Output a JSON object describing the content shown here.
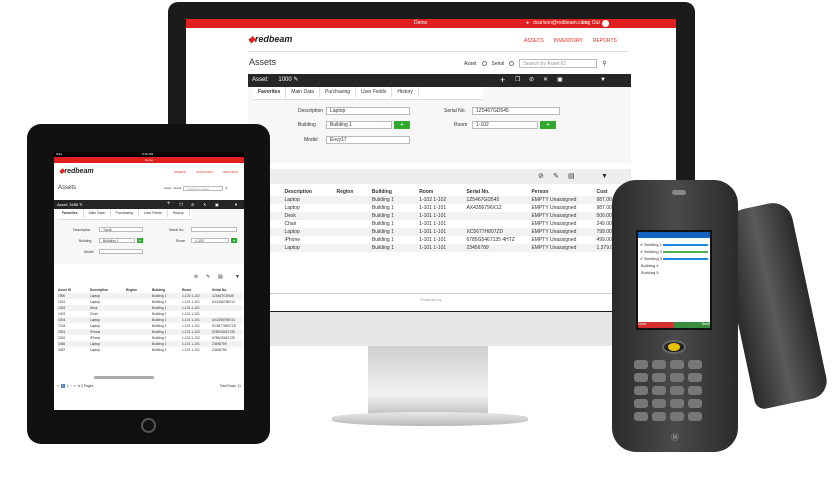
{
  "desktop": {
    "top": {
      "title": "Demo",
      "user": "dcarlson@redbeam.com",
      "logout": "Log Out"
    },
    "brand": "redbeam",
    "nav": [
      "ASSETS",
      "INVENTORY",
      "REPORTS"
    ],
    "page_title": "Assets",
    "search": {
      "opt1": "Asset",
      "opt2": "Serial",
      "placeholder": "Search by Asset ID"
    },
    "asset_label": "Asset:",
    "asset_id": "1000",
    "tabs": [
      "Favorites",
      "Main Data",
      "Purchasing",
      "User Fields",
      "History"
    ],
    "form": {
      "desc_l": "Description",
      "desc_v": "Laptop",
      "bld_l": "Building",
      "bld_v": "Building 1",
      "model_l": "Model",
      "model_v": "Envy17",
      "serial_l": "Serial No.",
      "serial_v": "1Z5467GD545",
      "room_l": "Room",
      "room_v": "1-102"
    },
    "table": {
      "headers": [
        "ID",
        "Description",
        "Region",
        "Building",
        "Room",
        "Serial No.",
        "Person",
        "Cost"
      ],
      "rows": [
        [
          "",
          "Laptop",
          "",
          "Building 1",
          "1-102 1-102",
          "1Z5467GD545",
          "EMPTY Unassigned",
          "987.00"
        ],
        [
          "",
          "Laptop",
          "",
          "Building 1",
          "1-101 1-101",
          "AX4356796X12",
          "EMPTY Unassigned",
          "987.00"
        ],
        [
          "",
          "Desk",
          "",
          "Building 1",
          "1-101 1-101",
          "",
          "EMPTY Unassigned",
          "500.00"
        ],
        [
          "",
          "Chair",
          "",
          "Building 1",
          "1-101 1-101",
          "",
          "EMPTY Unassigned",
          "249.00"
        ],
        [
          "",
          "Laptop",
          "",
          "Building 1",
          "1-101 1-101",
          "XC5677H807ZD",
          "EMPTY Unassigned",
          "799.00"
        ],
        [
          "",
          "iPhone",
          "",
          "Building 1",
          "1-101 1-101",
          "6785G5467135 4HTZ",
          "EMPTY Unassigned",
          "499.00"
        ],
        [
          "",
          "Laptop",
          "",
          "Building 1",
          "1-101 1-101",
          "23456789",
          "EMPTY Unassigned",
          "1,379.00"
        ]
      ]
    },
    "footer": "Powered by"
  },
  "tablet": {
    "status_left": "iPad",
    "status_center": "9:46 PM",
    "title": "Demo",
    "brand": "redbeam",
    "nav": [
      "ASSETS",
      "INVENTORY",
      "REPORTS"
    ],
    "page_title": "Assets",
    "search_opt": "Asset",
    "search_opt2": "Serial",
    "search_ph": "Search by Asset",
    "asset_label": "Asset:",
    "asset_id": "3456",
    "tabs": [
      "Favorites",
      "Main Data",
      "Purchasing",
      "User Fields",
      "History"
    ],
    "form": {
      "desc_l": "Description",
      "desc_v": "Truck",
      "bld_l": "Building",
      "bld_v": "Building 1",
      "model_l": "Model",
      "serial_l": "Serial No.",
      "room_l": "Room",
      "room_v": "1-101"
    },
    "table": {
      "headers": [
        "Asset ID",
        "Description",
        "Region",
        "Building",
        "Room",
        "Serial No."
      ],
      "rows": [
        [
          "7890",
          "Laptop",
          "",
          "Building 1",
          "1-102 1-102",
          "1Z5467GD545"
        ],
        [
          "1001",
          "Laptop",
          "",
          "Building 1",
          "1-101 1-101",
          "AX4356796X12"
        ],
        [
          "1002",
          "Desk",
          "",
          "Building 1",
          "1-101 1-101",
          ""
        ],
        [
          "1003",
          "Chair",
          "",
          "Building 1",
          "1-101 1-101",
          ""
        ],
        [
          "1004",
          "Laptop",
          "",
          "Building 1",
          "1-101 1-101",
          "AX4356796X14"
        ],
        [
          "7234",
          "Laptop",
          "",
          "Building 1",
          "1-101 1-101",
          "XC5677H807ZD"
        ],
        [
          "2001",
          "iPhone",
          "",
          "Building 1",
          "1-102 1-102",
          "6785G5467135"
        ],
        [
          "2002",
          "iPhone",
          "",
          "Building 1",
          "1-102 1-102",
          "6785G5467135"
        ],
        [
          "3456",
          "Laptop",
          "",
          "Building 1",
          "1-101 1-101",
          "23456789"
        ],
        [
          "3457",
          "Laptop",
          "",
          "Building 1",
          "1-101 1-101",
          "23456789"
        ]
      ]
    },
    "pages": [
      "1",
      "2"
    ],
    "pages_of": "of 2 Pages",
    "total": "Total Rows: 11"
  },
  "scanner": {
    "items": [
      "Building 1",
      "Building 2",
      "Building 3",
      "Building 4",
      "Building 5"
    ],
    "left_key": "Clear",
    "right_key": "Send"
  }
}
